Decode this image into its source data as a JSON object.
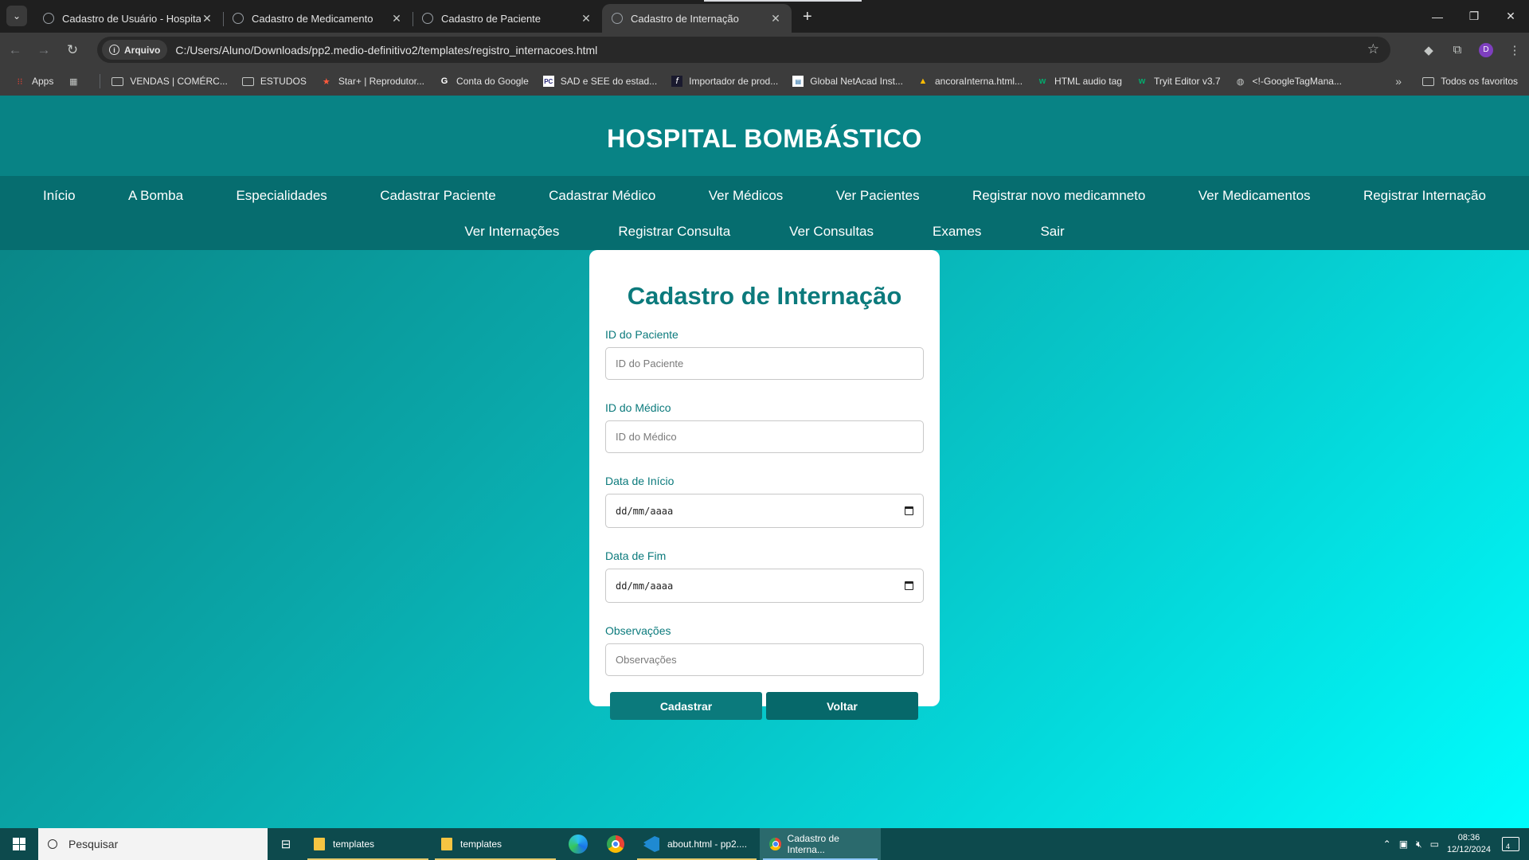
{
  "browser": {
    "tabs": [
      {
        "title": "Cadastro de Usuário - Hospital",
        "active": false
      },
      {
        "title": "Cadastro de Medicamento",
        "active": false
      },
      {
        "title": "Cadastro de Paciente",
        "active": false
      },
      {
        "title": "Cadastro de Internação",
        "active": true
      }
    ],
    "security_chip": "Arquivo",
    "url": "C:/Users/Aluno/Downloads/pp2.medio-definitivo2/templates/registro_internacoes.html",
    "profile_initial": "D",
    "bookmarks": [
      {
        "label": "Apps",
        "icon": "apps-grid-icon"
      },
      {
        "label": "VENDAS | COMÉRC...",
        "icon": "folder-icon"
      },
      {
        "label": "ESTUDOS",
        "icon": "folder-icon"
      },
      {
        "label": "Star+ | Reprodutor...",
        "icon": "star-plus-icon"
      },
      {
        "label": "Conta do Google",
        "icon": "google-icon"
      },
      {
        "label": "SAD e SEE do estad...",
        "icon": "pc-icon"
      },
      {
        "label": "Importador de prod...",
        "icon": "importer-icon"
      },
      {
        "label": "Global NetAcad Inst...",
        "icon": "netacad-icon"
      },
      {
        "label": "ancoraInterna.html...",
        "icon": "drive-icon"
      },
      {
        "label": "HTML audio tag",
        "icon": "w3schools-icon"
      },
      {
        "label": "Tryit Editor v3.7",
        "icon": "w3schools-icon"
      },
      {
        "label": "<!-GoogleTagMana...",
        "icon": "globe-icon"
      }
    ],
    "all_bookmarks": "Todos os favoritos"
  },
  "site": {
    "title": "HOSPITAL BOMBÁSTICO",
    "nav_row1": [
      "Início",
      "A Bomba",
      "Especialidades",
      "Cadastrar Paciente",
      "Cadastrar Médico",
      "Ver Médicos",
      "Ver Pacientes",
      "Registrar novo medicamneto",
      "Ver Medicamentos",
      "Registrar Internação"
    ],
    "nav_row2": [
      "Ver Internações",
      "Registrar Consulta",
      "Ver Consultas",
      "Exames",
      "Sair"
    ]
  },
  "form": {
    "heading": "Cadastro de Internação",
    "patient_id": {
      "label": "ID do Paciente",
      "placeholder": "ID do Paciente",
      "value": ""
    },
    "doctor_id": {
      "label": "ID do Médico",
      "placeholder": "ID do Médico",
      "value": ""
    },
    "start_date": {
      "label": "Data de Início",
      "display": "dd/mm/aaaa"
    },
    "end_date": {
      "label": "Data de Fim",
      "display": "dd/mm/aaaa"
    },
    "notes": {
      "label": "Observações",
      "placeholder": "Observações",
      "value": ""
    },
    "submit_label": "Cadastrar",
    "back_label": "Voltar"
  },
  "taskbar": {
    "search_placeholder": "Pesquisar",
    "items": [
      {
        "label": "templates",
        "icon": "file-explorer-icon"
      },
      {
        "label": "templates",
        "icon": "file-explorer-icon"
      },
      {
        "label": "about.html - pp2....",
        "icon": "vscode-icon"
      },
      {
        "label": "Cadastro de Interna...",
        "icon": "chrome-icon"
      }
    ],
    "time": "08:36",
    "date": "12/12/2024",
    "notification_count": "4"
  },
  "colors": {
    "header_bg": "#088385",
    "nav_bg": "#066d6f",
    "accent": "#0b7a7c",
    "gradient_end": "#00fdfd"
  }
}
